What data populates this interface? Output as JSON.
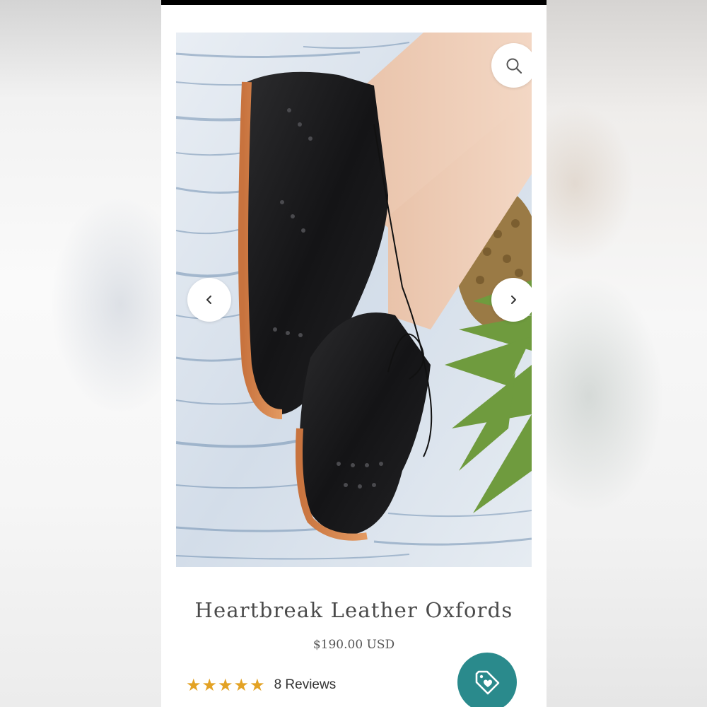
{
  "product": {
    "title": "Heartbreak Leather Oxfords",
    "price": "$190.00 USD",
    "rating": 5,
    "rating_max": 5,
    "reviews_label": "8 Reviews"
  },
  "gallery": {
    "zoom_icon": "search-icon",
    "prev_icon": "chevron-left-icon",
    "next_icon": "chevron-right-icon"
  },
  "actions": {
    "tag_icon": "tag-heart-icon"
  },
  "colors": {
    "accent": "#2a8a8c",
    "star": "#e3a224",
    "title": "#4a4a4a"
  }
}
